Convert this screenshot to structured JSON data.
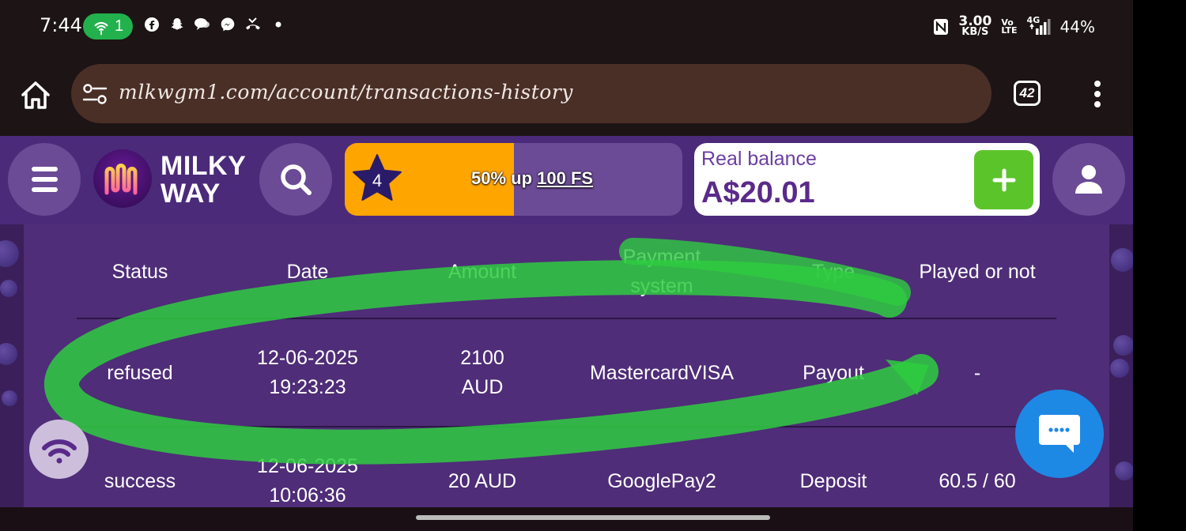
{
  "status_bar": {
    "time": "7:44",
    "hotspot_count": "1",
    "net_speed_value": "3.00",
    "net_speed_unit": "KB/S",
    "volte_top": "Vo",
    "volte_bottom": "LTE",
    "network": "4G",
    "battery": "44%"
  },
  "browser": {
    "url": "mlkwgm1.com/account/transactions-history",
    "tab_count": "42"
  },
  "header": {
    "logo_line1": "MILKY",
    "logo_line2": "WAY",
    "promo": {
      "level": "4",
      "text": "50% up ",
      "link": "100 FS",
      "progress_fraction": 0.5
    },
    "balance": {
      "label": "Real balance",
      "value": "A$20.01"
    }
  },
  "table": {
    "columns": [
      "Status",
      "Date",
      "Amount",
      "Payment system",
      "Type",
      "Played or not"
    ],
    "rows": [
      {
        "status": "refused",
        "date": "12-06-2025",
        "time": "19:23:23",
        "amount_value": "2100",
        "amount_currency": "AUD",
        "payment_system": "MastercardVISA",
        "type": "Payout",
        "played": "-"
      },
      {
        "status": "success",
        "date": "12-06-2025",
        "time": "10:06:36",
        "amount": "20 AUD",
        "payment_system": "GooglePay2",
        "type": "Deposit",
        "played": "60.5 / 60"
      }
    ]
  },
  "colors": {
    "header_bg": "#4b2a7a",
    "panel_bg": "#4f2d78",
    "promo_orange": "#ffa500",
    "deposit_green": "#5cc42b",
    "chat_blue": "#1e88e5",
    "scribble_green": "#2ecc40"
  },
  "icons": [
    "home-icon",
    "site-settings-icon",
    "tabs-icon",
    "more-vert-icon",
    "menu-icon",
    "search-icon",
    "star-icon",
    "plus-icon",
    "user-icon",
    "wifi-icon",
    "chat-icon"
  ]
}
